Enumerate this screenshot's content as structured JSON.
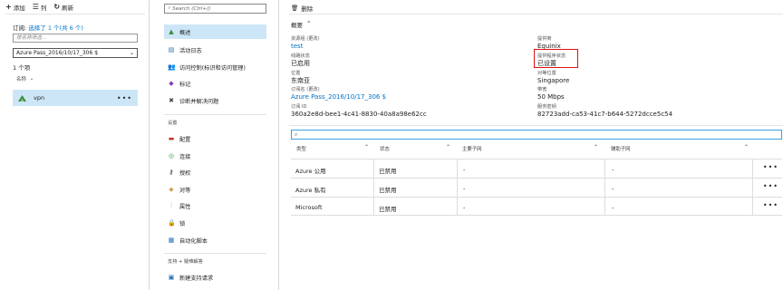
{
  "panel_list": {
    "toolbar": [
      {
        "icon": "+",
        "label": "添加"
      },
      {
        "icon": "☰",
        "label": "列"
      },
      {
        "icon": "↻",
        "label": "刷新"
      }
    ],
    "subscription_prefix": "订阅:",
    "subscription_link": "选择了 1 个(共 6 个)",
    "filter_placeholder": "按名称筛选...",
    "subscription_select": "Azure Pass_2016/10/17_306 $",
    "item_count": "1 个项",
    "column_header": "名称",
    "row": {
      "name": "vpn",
      "more": "•••"
    }
  },
  "panel_menu": {
    "search_placeholder": "Search (Ctrl+/)",
    "items_top": [
      {
        "label": "概述",
        "icon": "overview-icon",
        "glyph": "▲",
        "color": "#3a8a3a",
        "selected": true
      },
      {
        "label": "活动日志",
        "icon": "activity-log-icon",
        "glyph": "▤",
        "color": "#1f6fb5"
      },
      {
        "label": "访问控制(标识和访问管理)",
        "icon": "access-control-icon",
        "glyph": "👥",
        "color": "#1f6fb5"
      },
      {
        "label": "标记",
        "icon": "tag-icon",
        "glyph": "◆",
        "color": "#8a3ab5"
      },
      {
        "label": "诊断并解决问题",
        "icon": "diagnose-icon",
        "glyph": "✖",
        "color": "#444"
      }
    ],
    "section_settings": "设置",
    "items_settings": [
      {
        "label": "配置",
        "icon": "configuration-icon",
        "glyph": "▬",
        "color": "#c0392b"
      },
      {
        "label": "连接",
        "icon": "connection-icon",
        "glyph": "◎",
        "color": "#3a9a3a"
      },
      {
        "label": "授权",
        "icon": "key-icon",
        "glyph": "⚷",
        "color": "#222"
      },
      {
        "label": "对等",
        "icon": "peering-icon",
        "glyph": "◈",
        "color": "#c77a1a"
      },
      {
        "label": "属性",
        "icon": "properties-icon",
        "glyph": "⫶",
        "color": "#1f6fb5"
      },
      {
        "label": "锁",
        "icon": "lock-icon",
        "glyph": "🔒",
        "color": "#222"
      },
      {
        "label": "自动化脚本",
        "icon": "automation-script-icon",
        "glyph": "▦",
        "color": "#1f6fb5"
      }
    ],
    "section_support": "支持 + 疑难解答",
    "items_support": [
      {
        "label": "新建支持请求",
        "icon": "support-request-icon",
        "glyph": "▣",
        "color": "#1f6fb5"
      }
    ]
  },
  "panel_detail": {
    "delete_label": "删除",
    "essentials_label": "概要",
    "props_left": [
      {
        "label": "资源组 (更改)",
        "value": "test",
        "link": true
      },
      {
        "label": "线路状态",
        "value": "已启用"
      },
      {
        "label": "位置",
        "value": "东南亚"
      },
      {
        "label": "订阅名 (更改)",
        "value": "Azure Pass_2016/10/17_306 $",
        "link": true
      },
      {
        "label": "订阅 ID",
        "value": "360a2e8d-bee1-4c41-8830-40a8a98e62cc"
      }
    ],
    "props_right": [
      {
        "label": "提供商",
        "value": "Equinix"
      },
      {
        "label": "提供程序状态",
        "value": "已设置"
      },
      {
        "label": "对等位置",
        "value": "Singapore"
      },
      {
        "label": "带宽",
        "value": "50 Mbps"
      },
      {
        "label": "服务密钥",
        "value": "82723add-ca53-41c7-b644-5272dcce5c54"
      }
    ],
    "table": {
      "filter_placeholder": "",
      "columns": [
        "类型",
        "状态",
        "主要子网",
        "辅助子网"
      ],
      "rows": [
        {
          "type": "Azure 公用",
          "status": "已禁用",
          "primary": "-",
          "secondary": "-"
        },
        {
          "type": "Azure 私有",
          "status": "已禁用",
          "primary": "-",
          "secondary": "-"
        },
        {
          "type": "Microsoft",
          "status": "已禁用",
          "primary": "-",
          "secondary": "-"
        }
      ],
      "more": "•••"
    }
  }
}
